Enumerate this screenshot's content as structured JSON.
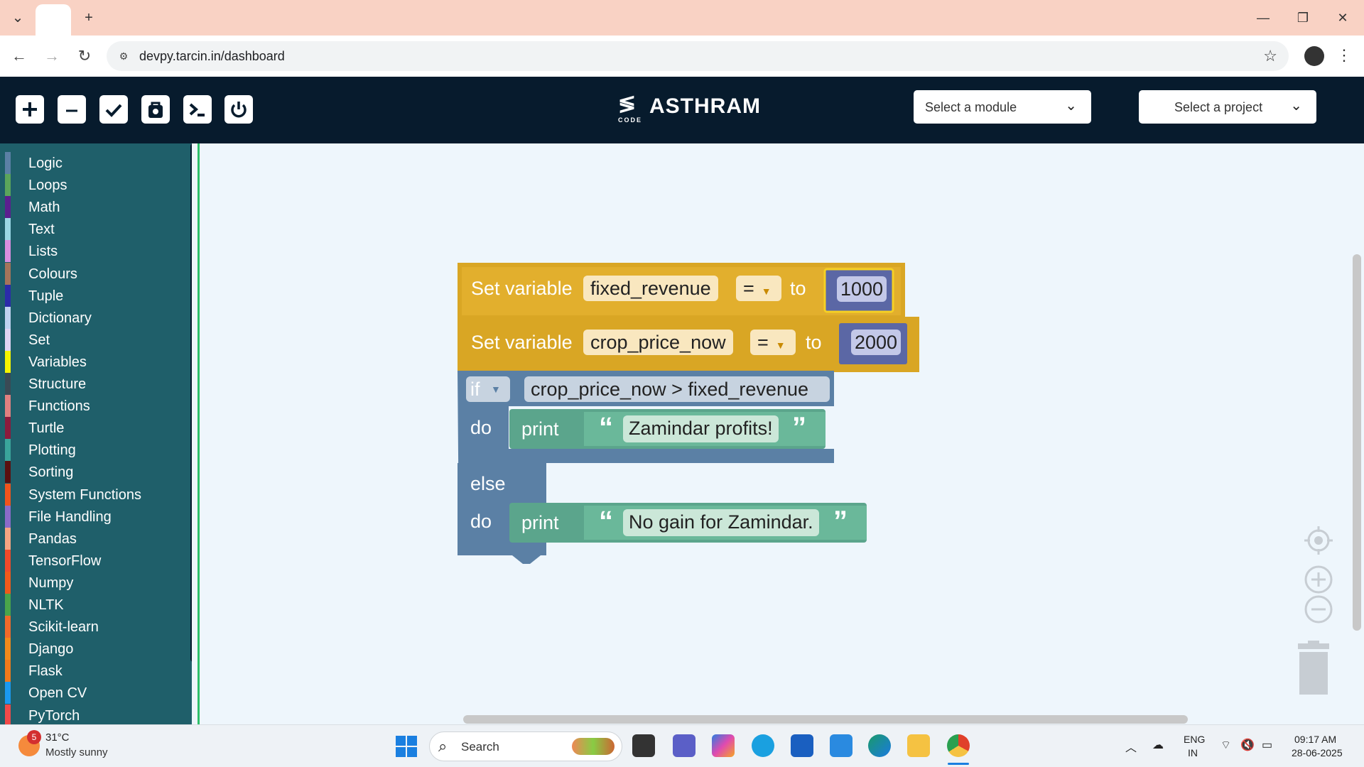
{
  "browser": {
    "new_tab_label": "+",
    "url": "devpy.tarcin.in/dashboard"
  },
  "app": {
    "logo_text": "ASTHRAM",
    "logo_sub": "CODE",
    "module_select": "Select a module",
    "project_select": "Select a project"
  },
  "sidebar": {
    "categories": [
      {
        "label": "Logic",
        "color": "#5b80a5"
      },
      {
        "label": "Loops",
        "color": "#5ba55b"
      },
      {
        "label": "Math",
        "color": "#5b1f8f"
      },
      {
        "label": "Text",
        "color": "#9ad7e4"
      },
      {
        "label": "Lists",
        "color": "#d98ee0"
      },
      {
        "label": "Colours",
        "color": "#a5745b"
      },
      {
        "label": "Tuple",
        "color": "#2b2baa"
      },
      {
        "label": "Dictionary",
        "color": "#bfd2ef"
      },
      {
        "label": "Set",
        "color": "#e0d4f2"
      },
      {
        "label": "Variables",
        "color": "#f5f500"
      },
      {
        "label": "Structure",
        "color": "#3a4a55"
      },
      {
        "label": "Functions",
        "color": "#e08080"
      },
      {
        "label": "Turtle",
        "color": "#8c1a3c"
      },
      {
        "label": "Plotting",
        "color": "#3aa59b"
      },
      {
        "label": "Sorting",
        "color": "#5a1010"
      },
      {
        "label": "System Functions",
        "color": "#f0541c"
      },
      {
        "label": "File Handling",
        "color": "#8a6bc9"
      },
      {
        "label": "Pandas",
        "color": "#f4a582"
      },
      {
        "label": "TensorFlow",
        "color": "#f04a2a"
      },
      {
        "label": "Numpy",
        "color": "#f05a1a"
      },
      {
        "label": "NLTK",
        "color": "#4aa54a"
      },
      {
        "label": "Scikit-learn",
        "color": "#f06a2a"
      },
      {
        "label": "Django",
        "color": "#f08a1a"
      },
      {
        "label": "Flask",
        "color": "#f07a1a"
      },
      {
        "label": "Open CV",
        "color": "#1a9af0"
      },
      {
        "label": "PyTorch",
        "color": "#f04a4a"
      }
    ]
  },
  "blocks": {
    "set1": {
      "label": "Set variable",
      "var": "fixed_revenue",
      "op": "=",
      "to": "to",
      "value": "1000"
    },
    "set2": {
      "label": "Set variable",
      "var": "crop_price_now",
      "op": "=",
      "to": "to",
      "value": "2000"
    },
    "if_block": {
      "keyword": "if",
      "condition": "crop_price_now > fixed_revenue",
      "do": "do",
      "else": "else",
      "do2": "do"
    },
    "print1": {
      "label": "print",
      "text": "Zamindar profits!"
    },
    "print2": {
      "label": "print",
      "text": "No gain for Zamindar."
    }
  },
  "taskbar": {
    "weather_badge": "5",
    "temperature": "31°C",
    "condition": "Mostly sunny",
    "search_label": "Search",
    "lang1": "ENG",
    "lang2": "IN",
    "time": "09:17 AM",
    "date": "28-06-2025"
  }
}
